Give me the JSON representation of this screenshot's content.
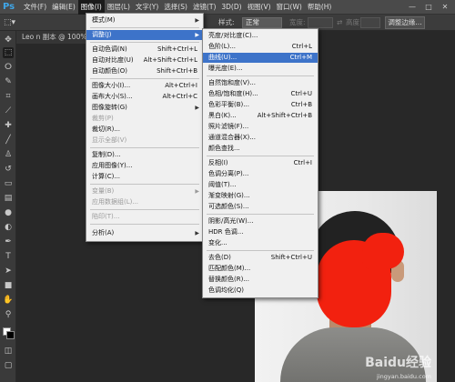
{
  "app": {
    "logo": "Ps"
  },
  "menubar": {
    "items": [
      {
        "label": "文件(F)"
      },
      {
        "label": "编辑(E)"
      },
      {
        "label": "图像(I)"
      },
      {
        "label": "图层(L)"
      },
      {
        "label": "文字(Y)"
      },
      {
        "label": "选择(S)"
      },
      {
        "label": "滤镜(T)"
      },
      {
        "label": "3D(D)"
      },
      {
        "label": "视图(V)"
      },
      {
        "label": "窗口(W)"
      },
      {
        "label": "帮助(H)"
      }
    ],
    "window_controls": {
      "minimize": "—",
      "restore": "□",
      "close": "✕"
    }
  },
  "options_bar": {
    "style_label": "样式:",
    "style_value": "正常",
    "width_label": "宽度:",
    "height_label": "高度:",
    "refine_edge": "调整边缘..."
  },
  "document_tab": {
    "title": "Leo n 副本 @ 100%"
  },
  "image_menu": {
    "items": [
      {
        "label": "模式(M)",
        "shortcut": "",
        "submenu": true
      },
      {
        "label": "调整(J)",
        "shortcut": "",
        "submenu": true,
        "highlighted": true
      },
      {
        "label": "自动色调(N)",
        "shortcut": "Shift+Ctrl+L"
      },
      {
        "label": "自动对比度(U)",
        "shortcut": "Alt+Shift+Ctrl+L"
      },
      {
        "label": "自动颜色(O)",
        "shortcut": "Shift+Ctrl+B"
      },
      {
        "label": "图像大小(I)...",
        "shortcut": "Alt+Ctrl+I"
      },
      {
        "label": "画布大小(S)...",
        "shortcut": "Alt+Ctrl+C"
      },
      {
        "label": "图像旋转(G)",
        "shortcut": "",
        "submenu": true
      },
      {
        "label": "裁剪(P)",
        "shortcut": "",
        "disabled": true
      },
      {
        "label": "裁切(R)...",
        "shortcut": ""
      },
      {
        "label": "显示全部(V)",
        "shortcut": "",
        "disabled": true
      },
      {
        "label": "复制(D)...",
        "shortcut": ""
      },
      {
        "label": "应用图像(Y)...",
        "shortcut": ""
      },
      {
        "label": "计算(C)...",
        "shortcut": ""
      },
      {
        "label": "变量(B)",
        "shortcut": "",
        "submenu": true,
        "disabled": true
      },
      {
        "label": "应用数据组(L)...",
        "shortcut": "",
        "disabled": true
      },
      {
        "label": "陷印(T)...",
        "shortcut": "",
        "disabled": true
      },
      {
        "label": "分析(A)",
        "shortcut": "",
        "submenu": true
      }
    ]
  },
  "adjust_submenu": {
    "items": [
      {
        "label": "亮度/对比度(C)...",
        "shortcut": ""
      },
      {
        "label": "色阶(L)...",
        "shortcut": "Ctrl+L"
      },
      {
        "label": "曲线(U)...",
        "shortcut": "Ctrl+M",
        "highlighted": true
      },
      {
        "label": "曝光度(E)...",
        "shortcut": ""
      },
      {
        "label": "自然饱和度(V)...",
        "shortcut": ""
      },
      {
        "label": "色相/饱和度(H)...",
        "shortcut": "Ctrl+U"
      },
      {
        "label": "色彩平衡(B)...",
        "shortcut": "Ctrl+B"
      },
      {
        "label": "黑白(K)...",
        "shortcut": "Alt+Shift+Ctrl+B"
      },
      {
        "label": "照片滤镜(F)...",
        "shortcut": ""
      },
      {
        "label": "通道混合器(X)...",
        "shortcut": ""
      },
      {
        "label": "颜色查找...",
        "shortcut": ""
      },
      {
        "label": "反相(I)",
        "shortcut": "Ctrl+I"
      },
      {
        "label": "色调分离(P)...",
        "shortcut": ""
      },
      {
        "label": "阈值(T)...",
        "shortcut": ""
      },
      {
        "label": "渐变映射(G)...",
        "shortcut": ""
      },
      {
        "label": "可选颜色(S)...",
        "shortcut": ""
      },
      {
        "label": "阴影/高光(W)...",
        "shortcut": ""
      },
      {
        "label": "HDR 色调...",
        "shortcut": ""
      },
      {
        "label": "变化...",
        "shortcut": ""
      },
      {
        "label": "去色(D)",
        "shortcut": "Shift+Ctrl+U"
      },
      {
        "label": "匹配颜色(M)...",
        "shortcut": ""
      },
      {
        "label": "替换颜色(R)...",
        "shortcut": ""
      },
      {
        "label": "色调均化(Q)",
        "shortcut": ""
      }
    ]
  },
  "toolbar": {
    "tools": [
      "move-tool-icon",
      "marquee-tool-icon",
      "lasso-tool-icon",
      "quick-select-tool-icon",
      "crop-tool-icon",
      "eyedropper-tool-icon",
      "healing-brush-tool-icon",
      "brush-tool-icon",
      "clone-stamp-tool-icon",
      "history-brush-tool-icon",
      "eraser-tool-icon",
      "gradient-tool-icon",
      "blur-tool-icon",
      "dodge-tool-icon",
      "pen-tool-icon",
      "type-tool-icon",
      "path-select-tool-icon",
      "shape-tool-icon",
      "hand-tool-icon",
      "zoom-tool-icon"
    ]
  },
  "watermark": {
    "text": "Baidu经验",
    "sub": "jingyan.baidu.com"
  },
  "colors": {
    "menubar": "#4a4a4a",
    "canvas": "#282828",
    "highlight": "#3d73c9",
    "face_cover": "#f2210f"
  }
}
